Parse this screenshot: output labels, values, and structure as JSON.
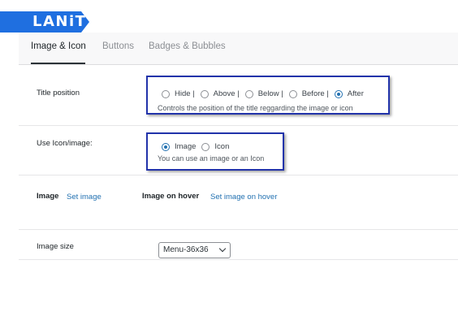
{
  "logo": {
    "text": "LANiT"
  },
  "tabs": [
    {
      "label": "Image & Icon"
    },
    {
      "label": "Buttons"
    },
    {
      "label": "Badges & Bubbles"
    }
  ],
  "title_position": {
    "label": "Title position",
    "options": [
      {
        "label": "Hide |",
        "checked": false
      },
      {
        "label": "Above |",
        "checked": false
      },
      {
        "label": "Below |",
        "checked": false
      },
      {
        "label": "Before |",
        "checked": false
      },
      {
        "label": "After",
        "checked": true
      }
    ],
    "description": "Controls the position of the title reggarding the image or icon"
  },
  "use_icon": {
    "label": "Use Icon/image:",
    "options": [
      {
        "label": "Image",
        "checked": true
      },
      {
        "label": "Icon",
        "checked": false
      }
    ],
    "description": "You can use an image or an Icon"
  },
  "image": {
    "label": "Image",
    "set_link": "Set image",
    "hover_label": "Image on hover",
    "hover_link": "Set image on hover"
  },
  "image_size": {
    "label": "Image size",
    "selected": "Menu-36x36"
  },
  "colors": {
    "accent": "#2271b1",
    "logo_bg": "#1f6fe0",
    "highlight_border": "#2233aa"
  }
}
